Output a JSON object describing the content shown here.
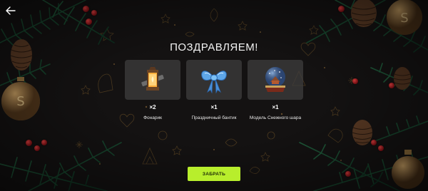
{
  "colors": {
    "background": "#141212",
    "tile": "#403e3e",
    "accent_button": "#b8ee2c",
    "button_text": "#1c2a06",
    "pattern_gold": "#b8873a"
  },
  "header": {
    "back_icon": "arrow-left-icon"
  },
  "title": "ПОЗДРАВЛЯЕМ!",
  "rewards": [
    {
      "icon": "lantern-icon",
      "quantity": "×2",
      "name": "Фонарик"
    },
    {
      "icon": "bow-icon",
      "quantity": "×1",
      "name": "Праздничный бантик"
    },
    {
      "icon": "snow-globe-icon",
      "quantity": "×1",
      "name": "Модель Снежного шара"
    }
  ],
  "claim_button_label": "ЗАБРАТЬ"
}
